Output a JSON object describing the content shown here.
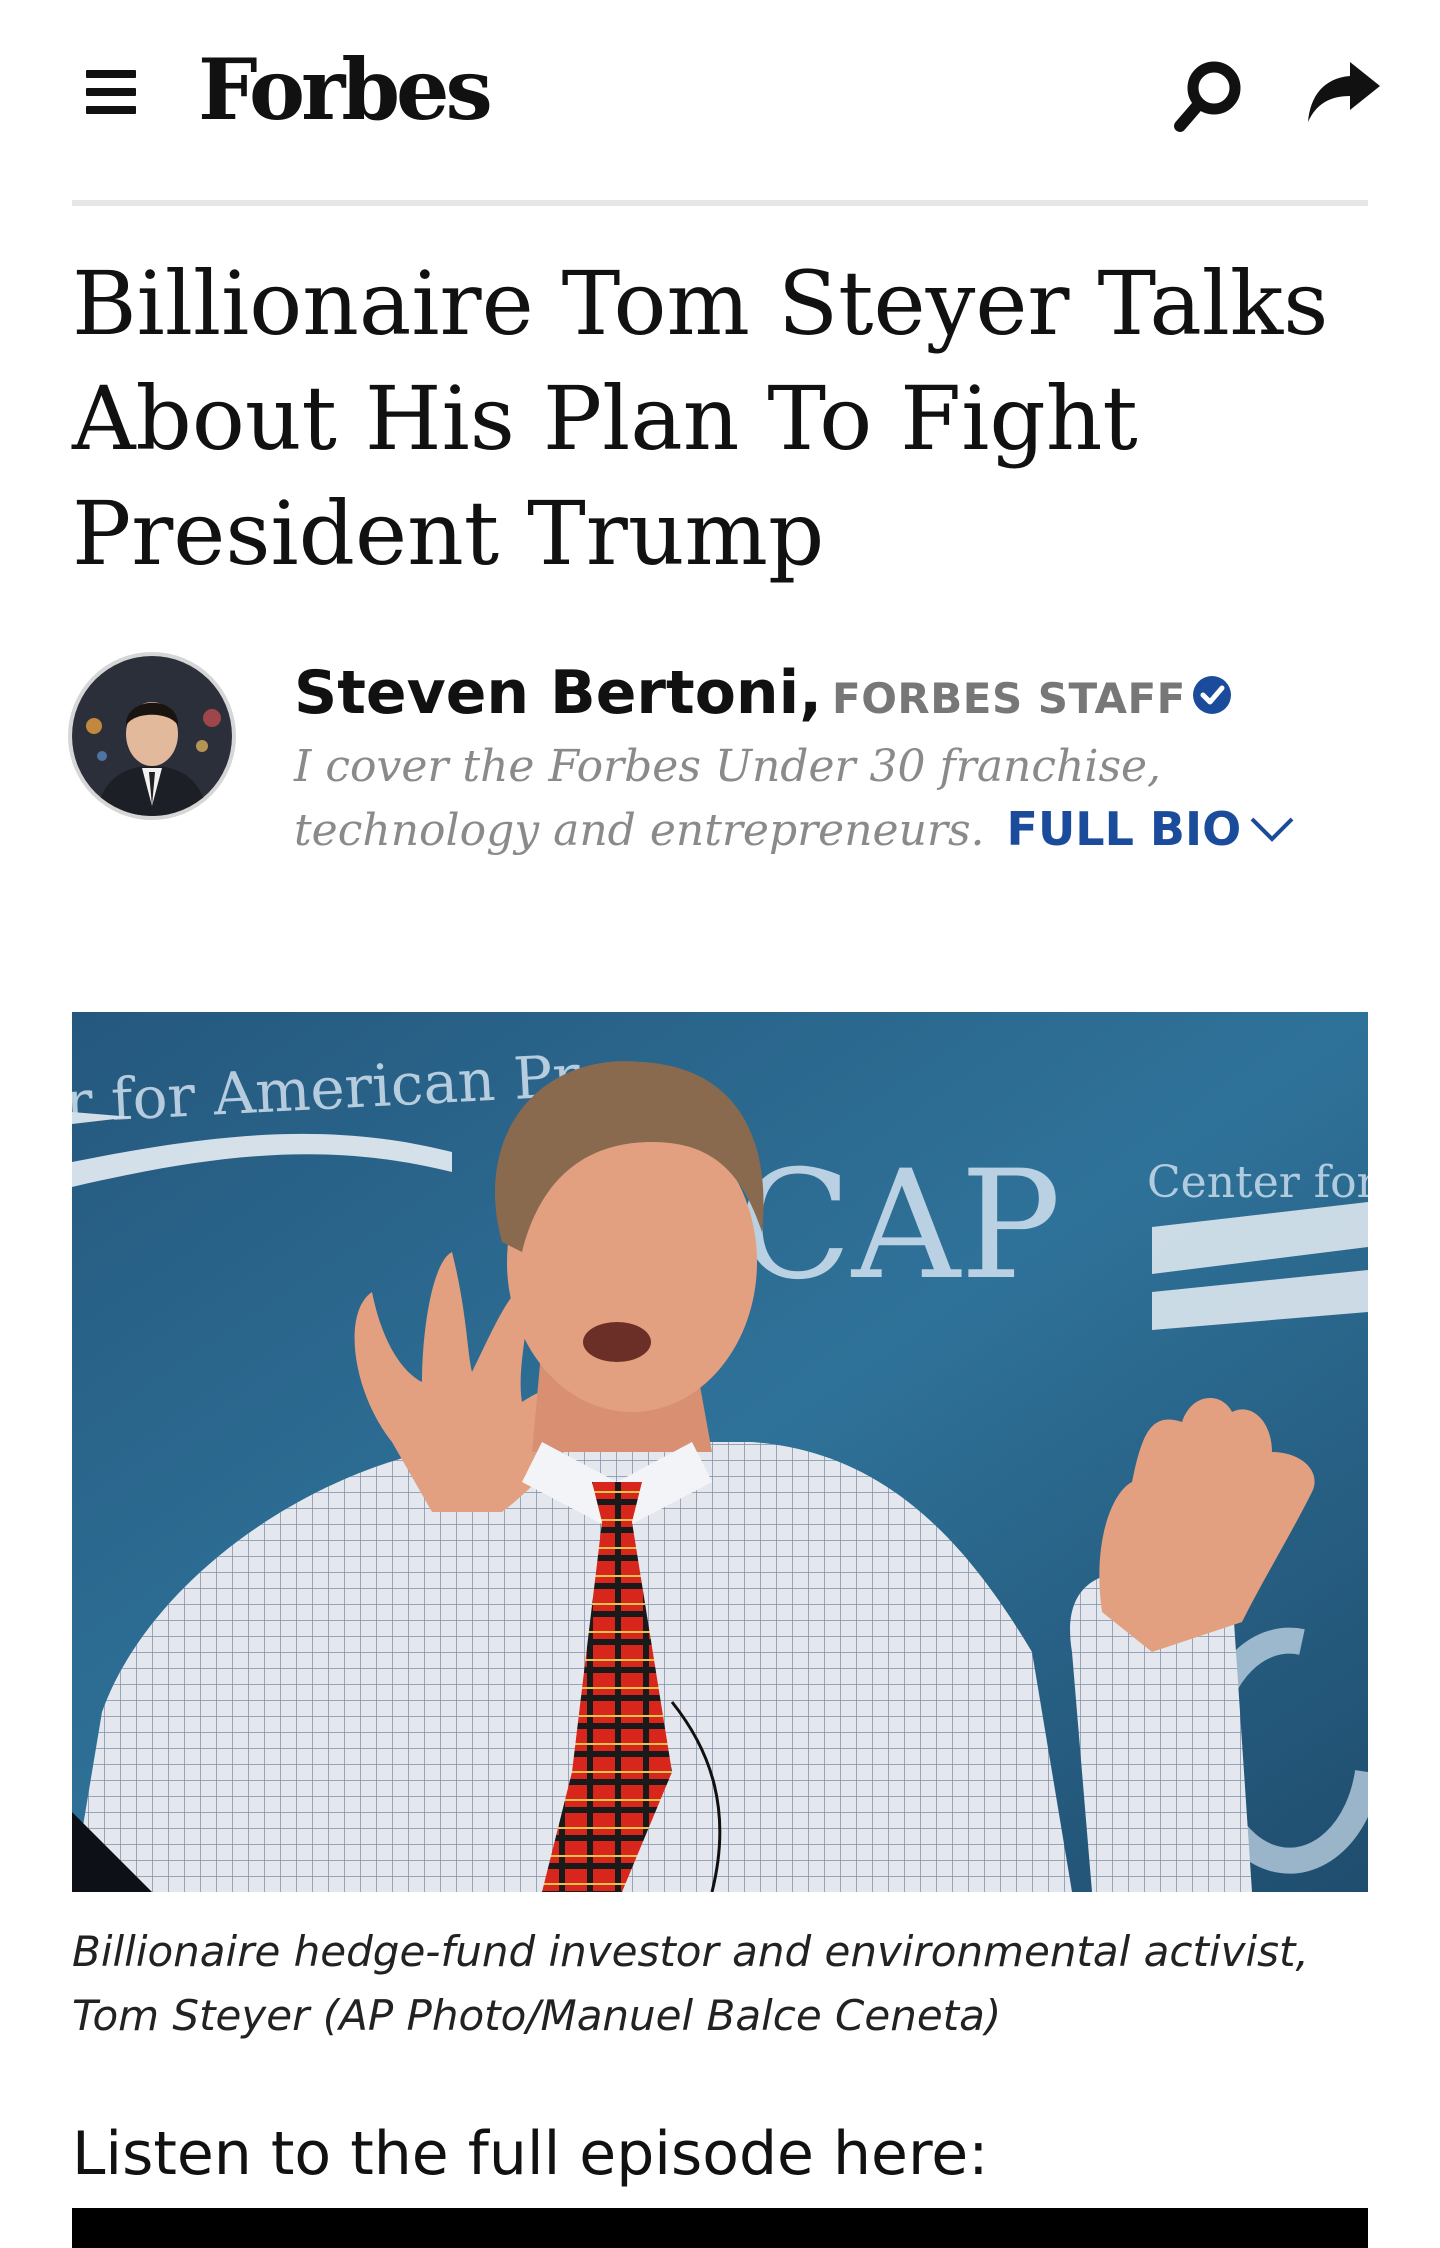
{
  "header": {
    "logo": "Forbes",
    "icons": [
      "menu-icon",
      "search-icon",
      "share-icon"
    ]
  },
  "article": {
    "title": "Billionaire Tom Steyer Talks About His Plan To Fight President Trump",
    "author": {
      "name": "Steven Bertoni,",
      "role": "FORBES STAFF",
      "bio": "I cover the Forbes Under 30 franchise, technology and entrepreneurs.",
      "full_bio_label": "FULL BIO"
    },
    "image": {
      "backdrop_text": "CAP",
      "backdrop_banner": "r for American Pr",
      "backdrop_banner_right": "Center for A"
    },
    "caption": "Billionaire hedge-fund investor and environmental activist, Tom Steyer (AP Photo/Manuel Balce Ceneta)",
    "listen_text": "Listen to the full episode here:"
  },
  "colors": {
    "link": "#1b4b9b",
    "muted": "#8a8a8a",
    "divider": "#e6e6e6",
    "hero_background": "#2a6a92"
  }
}
